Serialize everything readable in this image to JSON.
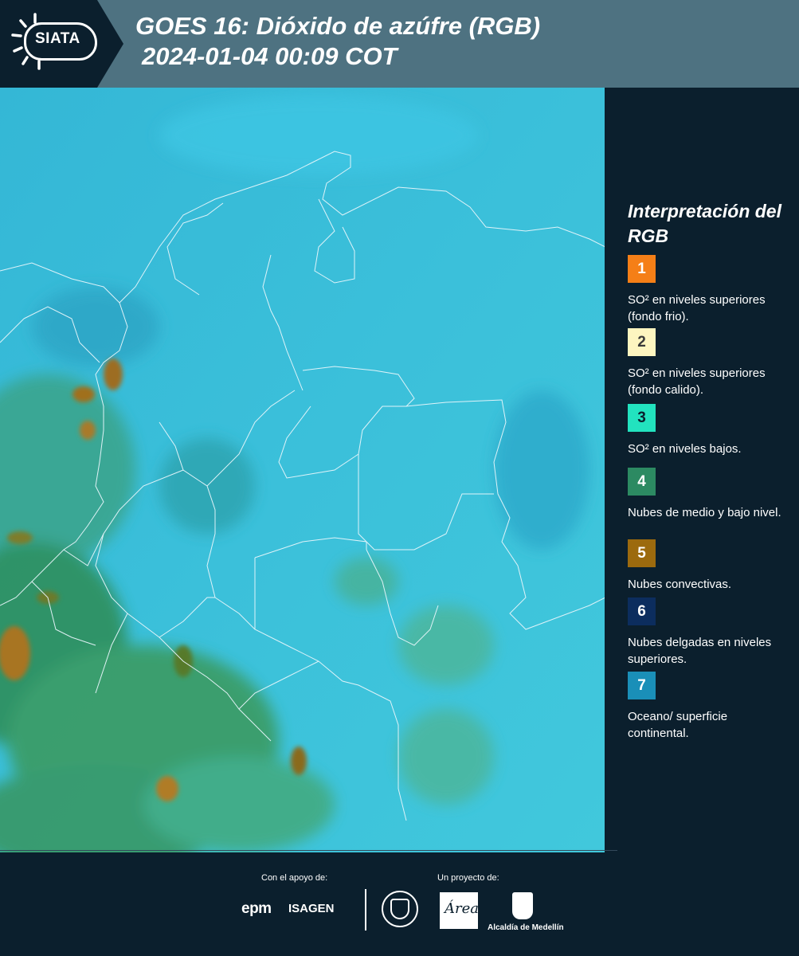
{
  "header": {
    "logo_text": "SIATA",
    "title_line1": "GOES 16: Dióxido de azúfre (RGB)",
    "title_line2": "2024-01-04 00:09 COT"
  },
  "legend": {
    "title": "Interpretación del RGB",
    "items": [
      {
        "number": "1",
        "color": "#f57f17",
        "text_color": "#ffffff",
        "label": "SO² en niveles superiores (fondo frio)."
      },
      {
        "number": "2",
        "color": "#fdf5c0",
        "text_color": "#3a3a3a",
        "label": "SO² en niveles superiores (fondo calido)."
      },
      {
        "number": "3",
        "color": "#22e3bf",
        "text_color": "#0b1f2d",
        "label": "SO² en niveles bajos."
      },
      {
        "number": "4",
        "color": "#2c8a62",
        "text_color": "#ffffff",
        "label": "Nubes de medio y bajo nivel."
      },
      {
        "number": "5",
        "color": "#9c6a0e",
        "text_color": "#ffffff",
        "label": "Nubes convectivas."
      },
      {
        "number": "6",
        "color": "#0c2d5e",
        "text_color": "#ffffff",
        "label": "Nubes delgadas en niveles superiores."
      },
      {
        "number": "7",
        "color": "#1a8fb8",
        "text_color": "#ffffff",
        "label": "Oceano/ superficie continental."
      }
    ]
  },
  "footer": {
    "support_label": "Con el apoyo de:",
    "project_label": "Un proyecto de:",
    "sponsor_1": "epm",
    "sponsor_2": "ISAGEN",
    "area_logo_text": "Área",
    "alcaldia": "Alcaldía de Medellín"
  }
}
